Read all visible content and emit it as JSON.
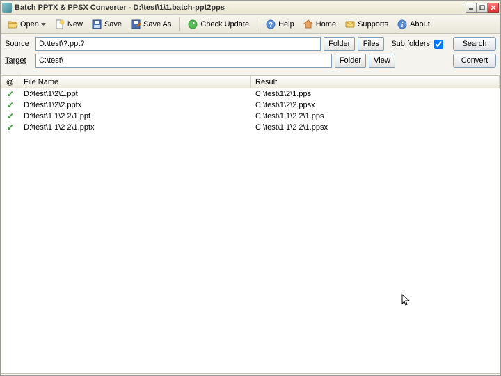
{
  "title": "Batch PPTX & PPSX Converter - D:\\test\\1\\1.batch-ppt2pps",
  "toolbar": {
    "open": "Open",
    "new": "New",
    "save": "Save",
    "save_as": "Save As",
    "check_update": "Check Update",
    "help": "Help",
    "home": "Home",
    "supports": "Supports",
    "about": "About"
  },
  "paths": {
    "source_label": "Source",
    "source_value": "D:\\test\\?.ppt?",
    "target_label": "Target",
    "target_value": "C:\\test\\",
    "folder_btn": "Folder",
    "files_btn": "Files",
    "view_btn": "View",
    "subfolders_label": "Sub folders",
    "subfolders_checked": true,
    "search_btn": "Search",
    "convert_btn": "Convert"
  },
  "columns": {
    "status": "@",
    "file": "File Name",
    "result": "Result"
  },
  "rows": [
    {
      "file": "D:\\test\\1\\2\\1.ppt",
      "result": "C:\\test\\1\\2\\1.pps"
    },
    {
      "file": "D:\\test\\1\\2\\2.pptx",
      "result": "C:\\test\\1\\2\\2.ppsx"
    },
    {
      "file": "D:\\test\\1 1\\2 2\\1.ppt",
      "result": "C:\\test\\1 1\\2 2\\1.pps"
    },
    {
      "file": "D:\\test\\1 1\\2 2\\1.pptx",
      "result": "C:\\test\\1 1\\2 2\\1.ppsx"
    }
  ]
}
